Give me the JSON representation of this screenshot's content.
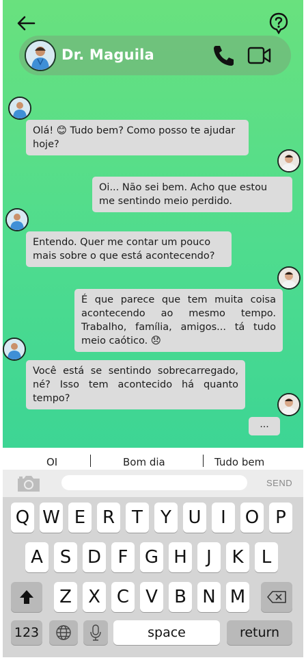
{
  "header": {
    "contact_name": "Dr. Maguila"
  },
  "messages": [
    {
      "from": "doctor",
      "text": "Olá! 😊 Tudo bem? Como posso te ajudar hoje?"
    },
    {
      "from": "user",
      "text": "Oi... Não sei bem. Acho que estou me sentindo meio perdido."
    },
    {
      "from": "doctor",
      "text": "Entendo. Quer me contar um pouco mais sobre o que está acontecendo?"
    },
    {
      "from": "user",
      "text": "É que parece que tem muita coisa acontecendo ao mesmo tempo. Trabalho, família, amigos... tá tudo meio caótico. 😞"
    },
    {
      "from": "doctor",
      "text": "Você está se sentindo sobrecarregado, né? Isso tem acontecido há quanto tempo?"
    },
    {
      "from": "user",
      "text": "..."
    }
  ],
  "suggestions": [
    "OI",
    "Bom dia",
    "Tudo bem"
  ],
  "composer": {
    "placeholder": "",
    "send_label": "SEND"
  },
  "keyboard": {
    "row1": [
      "Q",
      "W",
      "E",
      "R",
      "T",
      "Y",
      "U",
      "I",
      "O",
      "P"
    ],
    "row2": [
      "A",
      "S",
      "D",
      "F",
      "G",
      "H",
      "J",
      "K",
      "L"
    ],
    "row3": [
      "Z",
      "X",
      "C",
      "V",
      "B",
      "N",
      "M"
    ],
    "numbers_label": "123",
    "space_label": "space",
    "return_label": "return"
  },
  "colors": {
    "gradient_top": "#69e17e",
    "gradient_bottom": "#3dd594",
    "bubble": "#dcdcdc"
  },
  "icons": [
    "back-arrow-icon",
    "help-icon",
    "phone-icon",
    "video-camera-icon",
    "camera-icon",
    "shift-icon",
    "backspace-icon",
    "globe-icon",
    "microphone-icon"
  ]
}
